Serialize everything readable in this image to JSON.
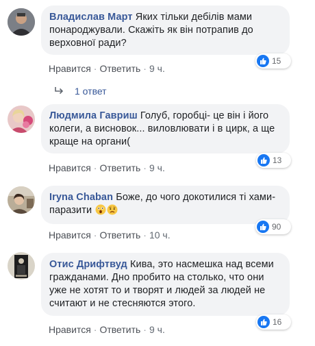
{
  "comments": [
    {
      "author": "Владислав Март",
      "text": "Яких тільки дебілів мами понароджували. Скажіть як він потрапив до верховної ради?",
      "likes": "15",
      "like_label": "Нравится",
      "reply_label": "Ответить",
      "time": "9 ч.",
      "avatar_color": "#5a5a5a"
    },
    {
      "author": "Людмила Гавриш",
      "text": "Голуб, горобці- це він і його колеги, а висновок... виловлювати і в цирк, а ще краще на органи(",
      "likes": "13",
      "like_label": "Нравится",
      "reply_label": "Ответить",
      "time": "9 ч.",
      "avatar_color": "#d86a8a"
    },
    {
      "author": "Iryna Chaban",
      "text": "Боже, до чого докотилися ті хами-паразити",
      "likes": "90",
      "like_label": "Нравится",
      "reply_label": "Ответить",
      "time": "10 ч.",
      "avatar_color": "#8a7a66"
    },
    {
      "author": "Отис Дрифтвуд",
      "text": "Кива, это насмешка над всеми гражданами. Дно пробито на столько, что они уже не хотят то и творят и людей за людей не считают и не стесняются этого.",
      "likes": "16",
      "like_label": "Нравится",
      "reply_label": "Ответить",
      "time": "9 ч.",
      "avatar_color": "#2b2b2b"
    }
  ],
  "replies_link": "1 ответ",
  "colors": {
    "author": "#385898",
    "bubble": "#f2f3f5",
    "like_blue": "#1877f2"
  },
  "icons": {
    "like": "thumbs-up-icon",
    "reply": "reply-arrow-icon",
    "emoji_shock": "astonished-emoji-icon",
    "emoji_sad": "worried-emoji-icon"
  }
}
